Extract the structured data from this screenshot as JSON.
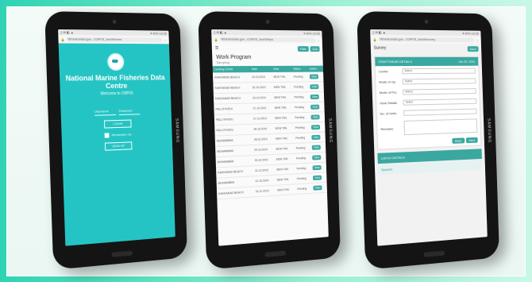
{
  "tablets": [
    {
      "statusbar": {
        "left": "▯ ✉ ◧ ▲",
        "right": "▾ 40% 10:26"
      },
      "browser": {
        "url": "fisheriesdata.gov.../CMFIS_test/#/home"
      },
      "login": {
        "title": "National Marine Fisheries Data Centre",
        "subtitle": "Welcome to CMFIS",
        "field_username": "Username",
        "field_password": "Password",
        "login_button": "LOGIN",
        "remember_label": "Remember me",
        "signup_button": "SIGN UP"
      },
      "brand": "SAMSUNG"
    },
    {
      "statusbar": {
        "left": "▯ ✉ ◧ ▲",
        "right": "▾ 40% 10:26"
      },
      "browser": {
        "url": "fisheriesdata.gov.../CMFIS_test/#/trips"
      },
      "app": {
        "heading": "Work Program",
        "subheading": "Sampling",
        "top_buttons": [
          "Filter",
          "Add"
        ],
        "columns": [
          "Landing Centre",
          "Date",
          "Gear",
          "Status",
          "Action"
        ],
        "rows": [
          [
            "KAKKANAD BEACH",
            "24.10.2019",
            "MDN TWL",
            "Pending",
            "View"
          ],
          [
            "KAKKANAD BEACH",
            "25.10.2019",
            "MDN TWL",
            "Pending",
            "View"
          ],
          [
            "KAKKANAD BEACH",
            "25.10.2019",
            "MDN TWL",
            "Pending",
            "View"
          ],
          [
            "PALLITHODU",
            "27.10.2019",
            "MDN TWL",
            "Pending",
            "View"
          ],
          [
            "PALLITHODU",
            "27.10.2019",
            "MDN TWL",
            "Pending",
            "View"
          ],
          [
            "PALLITHODU",
            "28.10.2019",
            "MDN TWL",
            "Pending",
            "View"
          ],
          [
            "MUNAMBAM",
            "28.10.2019",
            "MDN TWL",
            "Pending",
            "View"
          ],
          [
            "MUNAMBAM",
            "29.10.2019",
            "MDN TWL",
            "Pending",
            "View"
          ],
          [
            "MUNAMBAM",
            "30.10.2019",
            "MDN TWL",
            "Pending",
            "View"
          ],
          [
            "KAKKANAD BEACH",
            "31.10.2019",
            "MDN TWL",
            "Pending",
            "View"
          ],
          [
            "MUNAMBAM",
            "31.10.2019",
            "MDN TWL",
            "Pending",
            "View"
          ],
          [
            "KAKKANAD BEACH",
            "01.11.2019",
            "MDN TWL",
            "Pending",
            "View"
          ]
        ]
      },
      "brand": "SAMSUNG"
    },
    {
      "statusbar": {
        "left": "▯ ✉ ◧ ▲",
        "right": "▾ 40% 10:26"
      },
      "browser": {
        "url": "fisheriesdata.gov.../CMFIS_test/#/survey"
      },
      "app": {
        "heading": "Survey",
        "top_button": "Save",
        "card_title": "CRAFT/GEAR DETAILS",
        "card_date": "Jun 22, 2021",
        "form": [
          {
            "label": "Centre",
            "value": "Select"
          },
          {
            "label": "Mode of Op.",
            "value": "Select"
          },
          {
            "label": "Mode of Pro.",
            "value": "Select"
          },
          {
            "label": "Gear Details",
            "value": "Select"
          }
        ],
        "no_units_label": "No. of Units",
        "remarks_label": "Remarks",
        "actions": [
          "Back",
          "Next"
        ],
        "section1": "CATCH DETAILS",
        "section2": "Species"
      },
      "brand": "SAMSUNG"
    }
  ]
}
